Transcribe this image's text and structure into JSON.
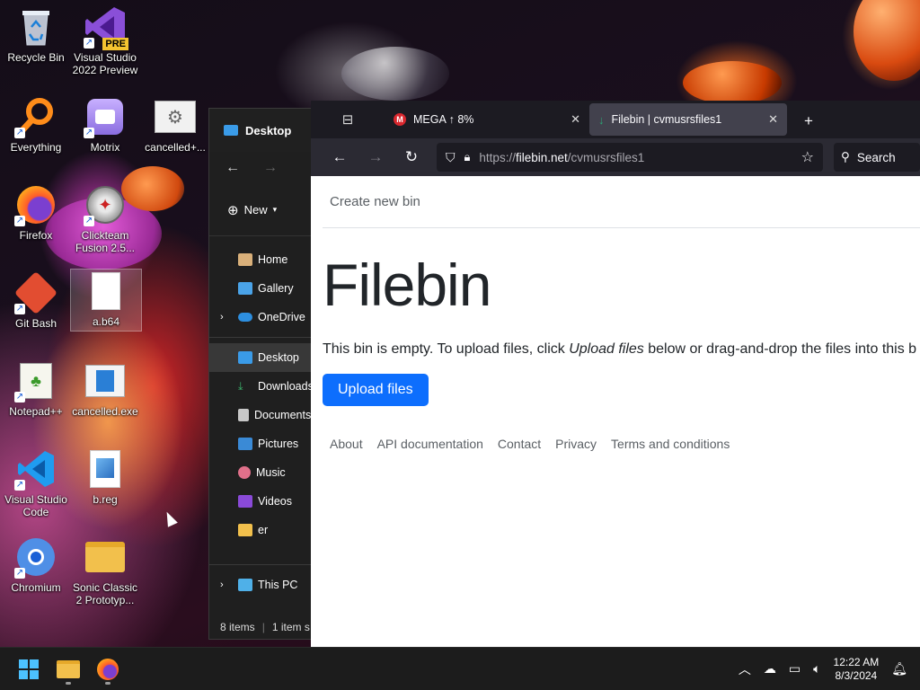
{
  "desktop": {
    "icons": [
      {
        "label": "Recycle Bin"
      },
      {
        "label": "Visual Studio 2022 Preview",
        "badge": "PRE"
      },
      {
        "label": "Everything"
      },
      {
        "label": "Motrix"
      },
      {
        "label": "cancelled+..."
      },
      {
        "label": "Firefox"
      },
      {
        "label": "Clickteam Fusion 2.5..."
      },
      {
        "label": "Git Bash"
      },
      {
        "label": "a.b64"
      },
      {
        "label": "Notepad++"
      },
      {
        "label": "cancelled.exe"
      },
      {
        "label": "Visual Studio Code"
      },
      {
        "label": "b.reg"
      },
      {
        "label": "Chromium"
      },
      {
        "label": "Sonic Classic 2 Prototyp..."
      }
    ]
  },
  "explorer": {
    "title": "Desktop",
    "new_label": "New",
    "nav_items": [
      {
        "label": "Home"
      },
      {
        "label": "Gallery"
      },
      {
        "label": "OneDrive"
      },
      {
        "label": "Desktop"
      },
      {
        "label": "Downloads"
      },
      {
        "label": "Documents"
      },
      {
        "label": "Pictures"
      },
      {
        "label": "Music"
      },
      {
        "label": "Videos"
      },
      {
        "label": "er"
      },
      {
        "label": "This PC"
      }
    ],
    "status_items": "8 items",
    "status_selected": "1 item s"
  },
  "browser": {
    "tabs": [
      {
        "title": "MEGA ↑ 8%"
      },
      {
        "title": "Filebin | cvmusrsfiles1"
      }
    ],
    "url_proto": "https://",
    "url_host": "filebin.net",
    "url_path": "/cvmusrsfiles1",
    "search_label": "Search",
    "page": {
      "nav_link": "Create new bin",
      "heading": "Filebin",
      "msg_before": "This bin is empty. To upload files, click ",
      "msg_em": "Upload files",
      "msg_after": " below or drag-and-drop the files into this b",
      "upload_label": "Upload files",
      "footer_links": [
        "About",
        "API documentation",
        "Contact",
        "Privacy",
        "Terms and conditions"
      ]
    }
  },
  "taskbar": {
    "time": "12:22 AM",
    "date": "8/3/2024"
  },
  "colors": {
    "accent": "#0d6efd",
    "browser_dark": "#1c1b22",
    "taskbar": "#1c1c1c"
  }
}
